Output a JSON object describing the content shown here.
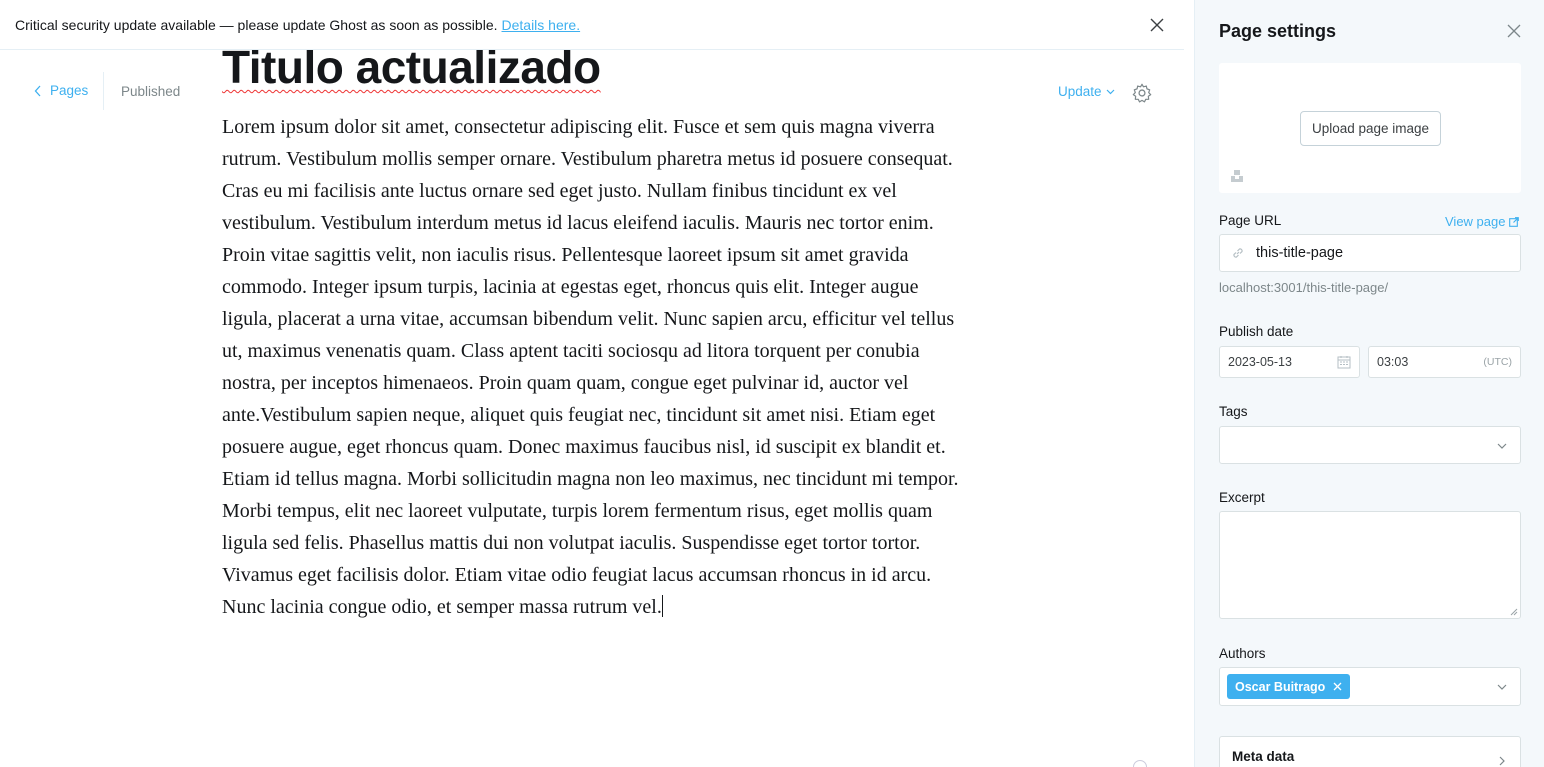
{
  "banner": {
    "message": "Critical security update available — please update Ghost as soon as possible.",
    "link_label": "Details here."
  },
  "editor_header": {
    "back_label": "Pages",
    "status": "Published",
    "update_label": "Update"
  },
  "post": {
    "title": "Titulo actualizado",
    "body": "Lorem ipsum dolor sit amet, consectetur adipiscing elit. Fusce et sem quis magna viverra rutrum. Vestibulum mollis semper ornare. Vestibulum pharetra metus id posuere consequat. Cras eu mi facilisis ante luctus ornare sed eget justo. Nullam finibus tincidunt ex vel vestibulum. Vestibulum interdum metus id lacus eleifend iaculis. Mauris nec tortor enim. Proin vitae sagittis velit, non iaculis risus. Pellentesque laoreet ipsum sit amet gravida commodo. Integer ipsum turpis, lacinia at egestas eget, rhoncus quis elit. Integer augue ligula, placerat a urna vitae, accumsan bibendum velit. Nunc sapien arcu, efficitur vel tellus ut, maximus venenatis quam. Class aptent taciti sociosqu ad litora torquent per conubia nostra, per inceptos himenaeos. Proin quam quam, congue eget pulvinar id, auctor vel ante.Vestibulum sapien neque, aliquet quis feugiat nec, tincidunt sit amet nisi. Etiam eget posuere augue, eget rhoncus quam. Donec maximus faucibus nisl, id suscipit ex blandit et. Etiam id tellus magna. Morbi sollicitudin magna non leo maximus, nec tincidunt mi tempor. Morbi tempus, elit nec laoreet vulputate, turpis lorem fermentum risus, eget mollis quam ligula sed felis. Phasellus mattis dui non volutpat iaculis. Suspendisse eget tortor tortor. Vivamus eget facilisis dolor. Etiam vitae odio feugiat lacus accumsan rhoncus in id arcu. Nunc lacinia congue odio, et semper massa rutrum vel."
  },
  "settings": {
    "title": "Page settings",
    "upload_label": "Upload page image",
    "url_label": "Page URL",
    "view_page_label": "View page",
    "url_value": "this-title-page",
    "url_hint": "localhost:3001/this-title-page/",
    "publish_date_label": "Publish date",
    "date_value": "2023-05-13",
    "time_value": "03:03",
    "timezone": "(UTC)",
    "tags_label": "Tags",
    "excerpt_label": "Excerpt",
    "authors_label": "Authors",
    "author_name": "Oscar Buitrago",
    "meta_label": "Meta data"
  },
  "colors": {
    "accent": "#3eb0ef",
    "panel_bg": "#f4f8fb"
  }
}
